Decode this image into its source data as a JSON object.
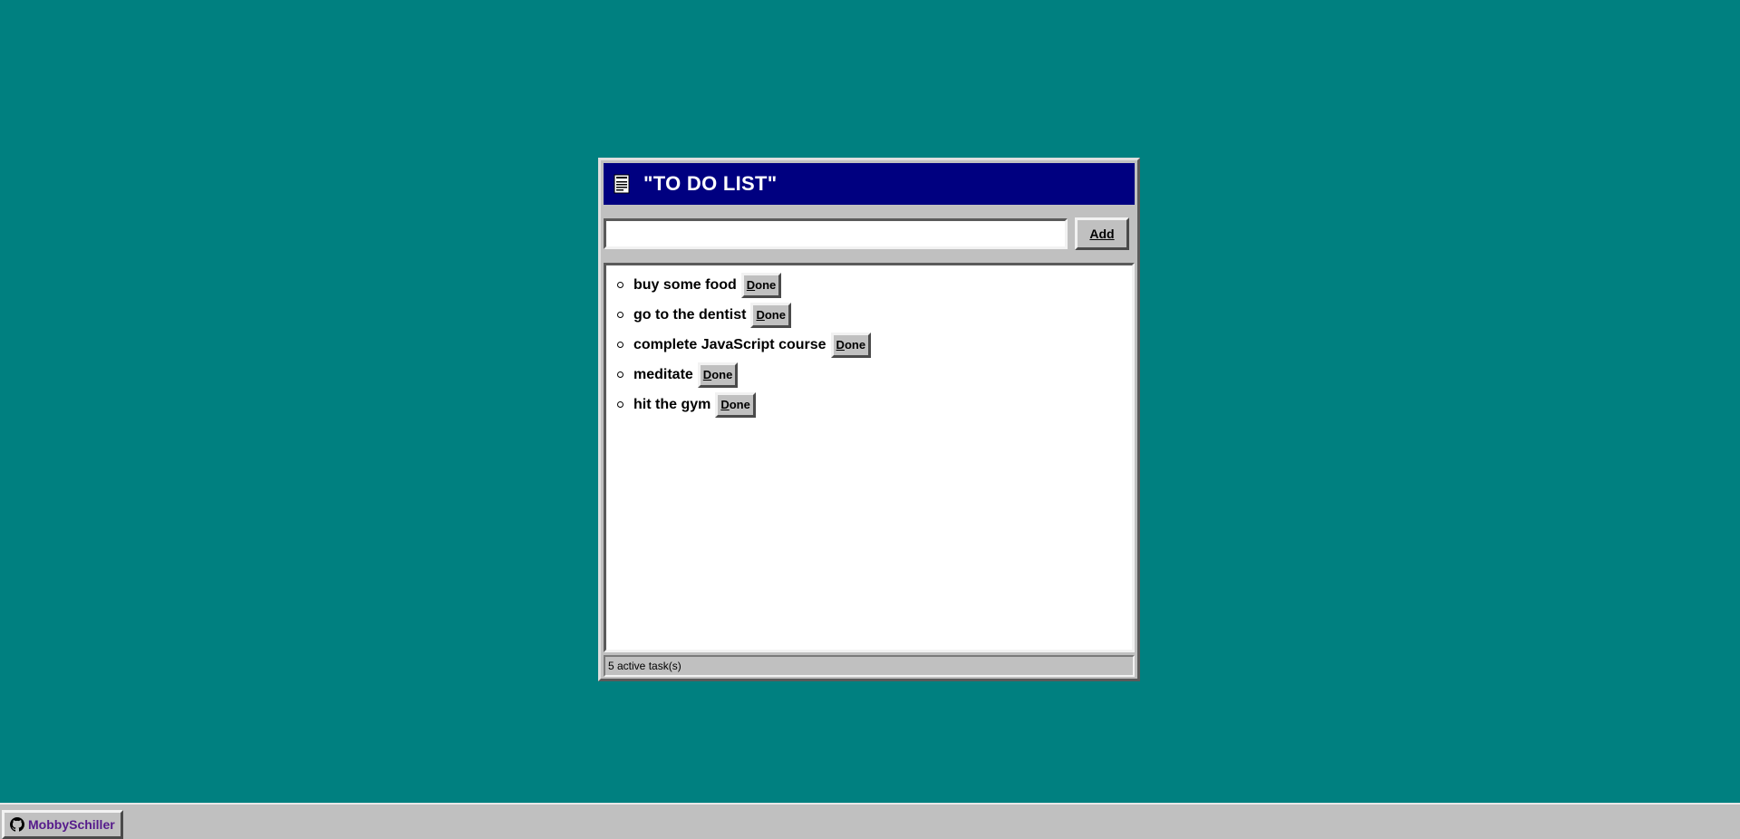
{
  "window": {
    "title": "\"TO DO LIST\"",
    "icon": "notepad-icon"
  },
  "input": {
    "value": "",
    "placeholder": ""
  },
  "add_button": {
    "label_first": "A",
    "label_rest": "dd"
  },
  "tasks": [
    {
      "label": "buy some food",
      "button_first": "D",
      "button_rest": "one"
    },
    {
      "label": "go to the dentist",
      "button_first": "D",
      "button_rest": "one"
    },
    {
      "label": "complete JavaScript course",
      "button_first": "D",
      "button_rest": "one"
    },
    {
      "label": "meditate",
      "button_first": "D",
      "button_rest": "one"
    },
    {
      "label": "hit the gym",
      "button_first": "D",
      "button_rest": "one"
    }
  ],
  "status": {
    "text": "5 active task(s)"
  },
  "taskbar": {
    "label": "MobbySchiller",
    "icon": "github-icon"
  },
  "colors": {
    "desktop": "#008080",
    "titlebar": "#000080",
    "window": "#c0c0c0",
    "link": "#551a8b"
  }
}
